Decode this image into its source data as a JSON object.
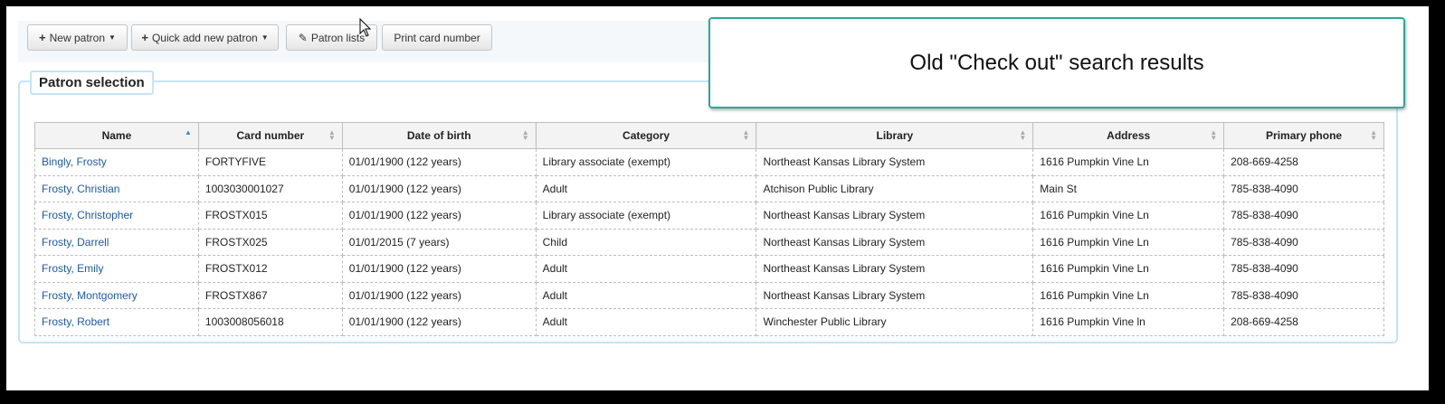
{
  "toolbar": {
    "new_patron": "New patron",
    "quick_add": "Quick add new patron",
    "patron_lists": "Patron lists",
    "print_card": "Print card number"
  },
  "overlay_text": "Old \"Check out\" search results",
  "section_title": "Patron selection",
  "table": {
    "headers": [
      "Name",
      "Card number",
      "Date of birth",
      "Category",
      "Library",
      "Address",
      "Primary phone"
    ],
    "sorted_column": "Name",
    "rows": [
      [
        "Bingly, Frosty",
        "FORTYFIVE",
        "01/01/1900 (122 years)",
        "Library associate (exempt)",
        "Northeast Kansas Library System",
        "1616 Pumpkin Vine Ln",
        "208-669-4258"
      ],
      [
        "Frosty, Christian",
        "1003030001027",
        "01/01/1900 (122 years)",
        "Adult",
        "Atchison Public Library",
        "Main St",
        "785-838-4090"
      ],
      [
        "Frosty, Christopher",
        "FROSTX015",
        "01/01/1900 (122 years)",
        "Library associate (exempt)",
        "Northeast Kansas Library System",
        "1616 Pumpkin Vine Ln",
        "785-838-4090"
      ],
      [
        "Frosty, Darrell",
        "FROSTX025",
        "01/01/2015 (7 years)",
        "Child",
        "Northeast Kansas Library System",
        "1616 Pumpkin Vine Ln",
        "785-838-4090"
      ],
      [
        "Frosty, Emily",
        "FROSTX012",
        "01/01/1900 (122 years)",
        "Adult",
        "Northeast Kansas Library System",
        "1616 Pumpkin Vine Ln",
        "785-838-4090"
      ],
      [
        "Frosty, Montgomery",
        "FROSTX867",
        "01/01/1900 (122 years)",
        "Adult",
        "Northeast Kansas Library System",
        "1616 Pumpkin Vine Ln",
        "785-838-4090"
      ],
      [
        "Frosty, Robert",
        "1003008056018",
        "01/01/1900 (122 years)",
        "Adult",
        "Winchester Public Library",
        "1616 Pumpkin Vine ln",
        "208-669-4258"
      ]
    ]
  },
  "colors": {
    "link": "#1e5aa8",
    "overlay_border": "#2ba99a",
    "fieldset_border": "#c6e4f5"
  },
  "icons": [
    "plus-icon",
    "caret-down-icon",
    "edit-icon",
    "sort-icon",
    "mouse-cursor-icon"
  ]
}
